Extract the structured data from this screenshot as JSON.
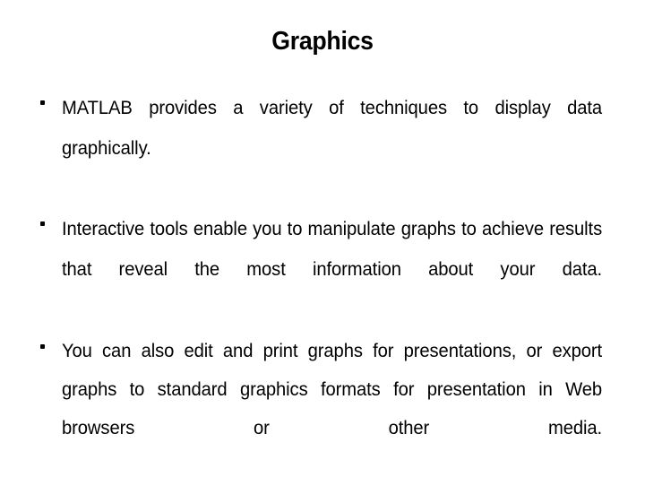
{
  "slide": {
    "title": "Graphics",
    "background_color": "#ffffff",
    "text_color": "#000000",
    "bullets": [
      {
        "marker": "square-bullet",
        "text": "MATLAB provides a variety of techniques to display data graphically."
      },
      {
        "marker": "square-bullet",
        "text": "Interactive tools enable you to manipulate graphs to achieve results that reveal the most information about your data."
      },
      {
        "marker": "square-bullet",
        "text": "You can also edit and print graphs for presentations, or export graphs to standard graphics formats for presentation in Web browsers or other media."
      }
    ]
  }
}
